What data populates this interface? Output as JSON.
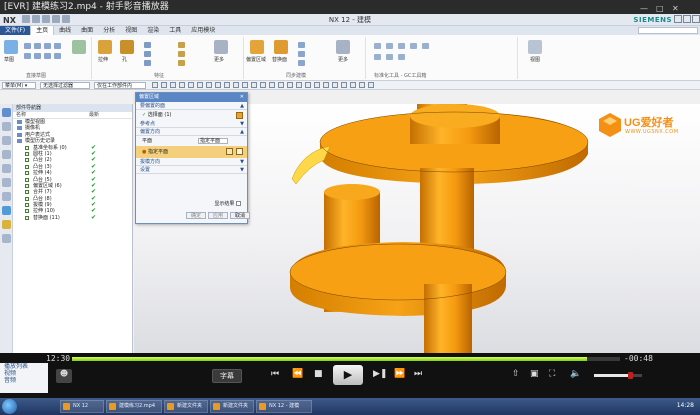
{
  "player": {
    "title": "[EVR] 建模练习2.mp4 - 射手影音播放器",
    "time_current": "12:30",
    "time_remaining": "-00:48",
    "subtitle_button": "字幕",
    "progress": 0.94,
    "volume": 0.78
  },
  "nx": {
    "logo": "NX",
    "window_title": "NX 12 - 建模",
    "brand": "SIEMENS",
    "tabs": [
      "文件(F)",
      "主页",
      "曲线",
      "曲面",
      "分析",
      "视图",
      "渲染",
      "工具",
      "应用模块"
    ],
    "active_tab": 1,
    "ribbon_groups": [
      "直接草图",
      "特征",
      "同步建模",
      "标准化工具 - GC工具箱"
    ],
    "ribbon_big_labels": [
      "草图",
      "拉伸",
      "孔",
      "更多",
      "偏置区域",
      "替换面",
      "更多",
      "视图"
    ],
    "selbar": {
      "filter": "菜单(M) ▾",
      "type": "无选择过滤器",
      "scope": "仅在工作部件内"
    }
  },
  "navigator": {
    "title": "部件导航器",
    "col_name": "名称",
    "col_latest": "最新",
    "rows": [
      {
        "label": "模型视图",
        "indent": 0,
        "check": false,
        "folder": true
      },
      {
        "label": "摄像机",
        "indent": 0,
        "check": false,
        "folder": true
      },
      {
        "label": "用户表达式",
        "indent": 0,
        "check": false,
        "folder": true
      },
      {
        "label": "模型历史记录",
        "indent": 0,
        "check": false,
        "folder": true
      },
      {
        "label": "基准坐标系 (0)",
        "indent": 1,
        "check": true
      },
      {
        "label": "圆柱 (1)",
        "indent": 1,
        "check": true
      },
      {
        "label": "凸台 (2)",
        "indent": 1,
        "check": true
      },
      {
        "label": "凸台 (3)",
        "indent": 1,
        "check": true
      },
      {
        "label": "拉伸 (4)",
        "indent": 1,
        "check": true
      },
      {
        "label": "凸台 (5)",
        "indent": 1,
        "check": true
      },
      {
        "label": "偏置区域 (6)",
        "indent": 1,
        "check": true
      },
      {
        "label": "合并 (7)",
        "indent": 1,
        "check": true
      },
      {
        "label": "凸台 (8)",
        "indent": 1,
        "check": true
      },
      {
        "label": "拔模 (9)",
        "indent": 1,
        "check": true
      },
      {
        "label": "拉伸 (10)",
        "indent": 1,
        "check": true
      },
      {
        "label": "替换面 (11)",
        "indent": 1,
        "check": true
      }
    ]
  },
  "dialog": {
    "title": "偏置区域",
    "sec_face": "要偏置的面",
    "select_face": "选择面 (1)",
    "sec_ref": "参考点",
    "sec_reverse": "偏置方向",
    "label_plane": "平面",
    "field_value": "指定平面",
    "hl_label": "指定平面",
    "sec_draft": "拔模方向",
    "sec_keep": "设置",
    "preview": "显示结果",
    "btn_ok": "确定",
    "btn_apply": "应用",
    "btn_cancel": "取消"
  },
  "watermark": {
    "brand": "UG爱好者",
    "url": "WWW.UGSNX.COM"
  },
  "side_list": [
    "播放列表",
    "视频",
    "音频"
  ],
  "taskbar": {
    "items": [
      "NX 12",
      "建模练习2.mp4",
      "新建文件夹",
      "新建文件夹",
      "NX 12 - 建模"
    ],
    "clock": "14:28"
  },
  "colors": {
    "part_orange": "#f39a0e",
    "progress_fill": "#8fdc1e",
    "dialog_header": "#5b86c5",
    "highlight": "#f5d07c"
  }
}
